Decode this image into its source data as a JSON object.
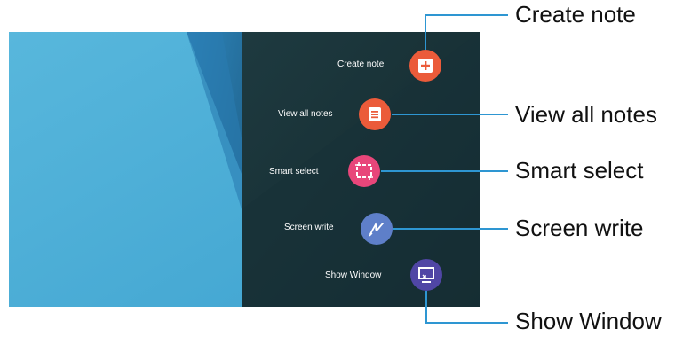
{
  "menu": {
    "items": [
      {
        "id": "create-note",
        "label": "Create note",
        "icon": "note-plus-icon",
        "color": "#EB5B3A"
      },
      {
        "id": "view-all-notes",
        "label": "View all notes",
        "icon": "notes-list-icon",
        "color": "#EB5B3A"
      },
      {
        "id": "smart-select",
        "label": "Smart select",
        "icon": "crop-select-icon",
        "color": "#E8467A"
      },
      {
        "id": "screen-write",
        "label": "Screen write",
        "icon": "pen-write-icon",
        "color": "#5E7FC9"
      },
      {
        "id": "show-window",
        "label": "Show Window",
        "icon": "window-cast-icon",
        "color": "#5046A5"
      }
    ]
  },
  "callouts": {
    "create_note": "Create note",
    "view_all_notes": "View all notes",
    "smart_select": "Smart select",
    "screen_write": "Screen write",
    "show_window": "Show Window"
  },
  "colors": {
    "panel": "#1E3A3E",
    "wallpaper_light": "#4FB0D8",
    "wallpaper_dark": "#2A7FB4",
    "callout_line": "#2E96D2"
  }
}
